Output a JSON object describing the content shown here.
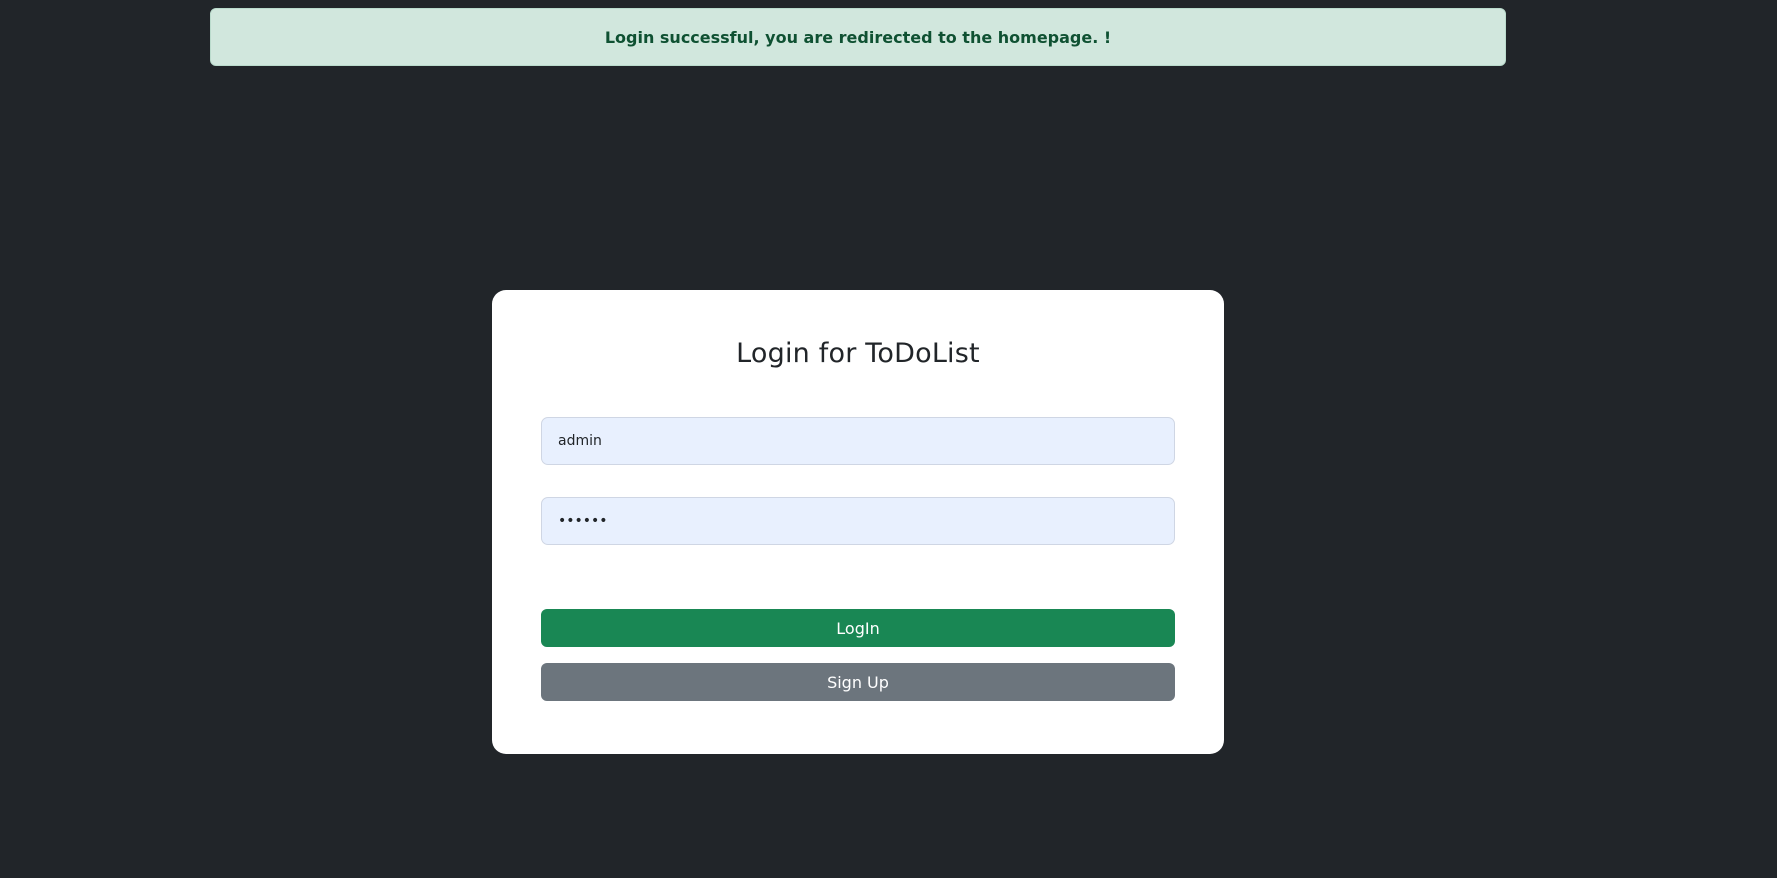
{
  "alert": {
    "message": "Login successful, you are redirected to the homepage. !"
  },
  "login_card": {
    "title": "Login for ToDoList",
    "username": {
      "value": "admin"
    },
    "password": {
      "value": "••••••"
    },
    "login_label": "LogIn",
    "signup_label": "Sign Up"
  },
  "colors": {
    "background": "#212529",
    "alert_bg": "#d1e7dd",
    "alert_text": "#0f5132",
    "login_button": "#198754",
    "signup_button": "#6c757d",
    "input_bg": "#e8f0fe"
  }
}
